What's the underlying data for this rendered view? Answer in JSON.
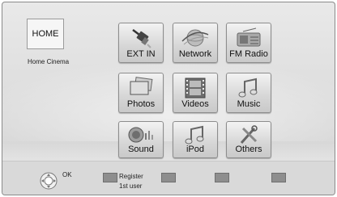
{
  "home": {
    "title": "HOME",
    "subtitle": "Home Cinema"
  },
  "tiles": [
    {
      "label": "EXT IN"
    },
    {
      "label": "Network"
    },
    {
      "label": "FM Radio"
    },
    {
      "label": "Photos"
    },
    {
      "label": "Videos"
    },
    {
      "label": "Music"
    },
    {
      "label": "Sound"
    },
    {
      "label": "iPod"
    },
    {
      "label": "Others"
    }
  ],
  "footer": {
    "ok_label": "OK",
    "register_line1": "Register",
    "register_line2": "1st user"
  }
}
